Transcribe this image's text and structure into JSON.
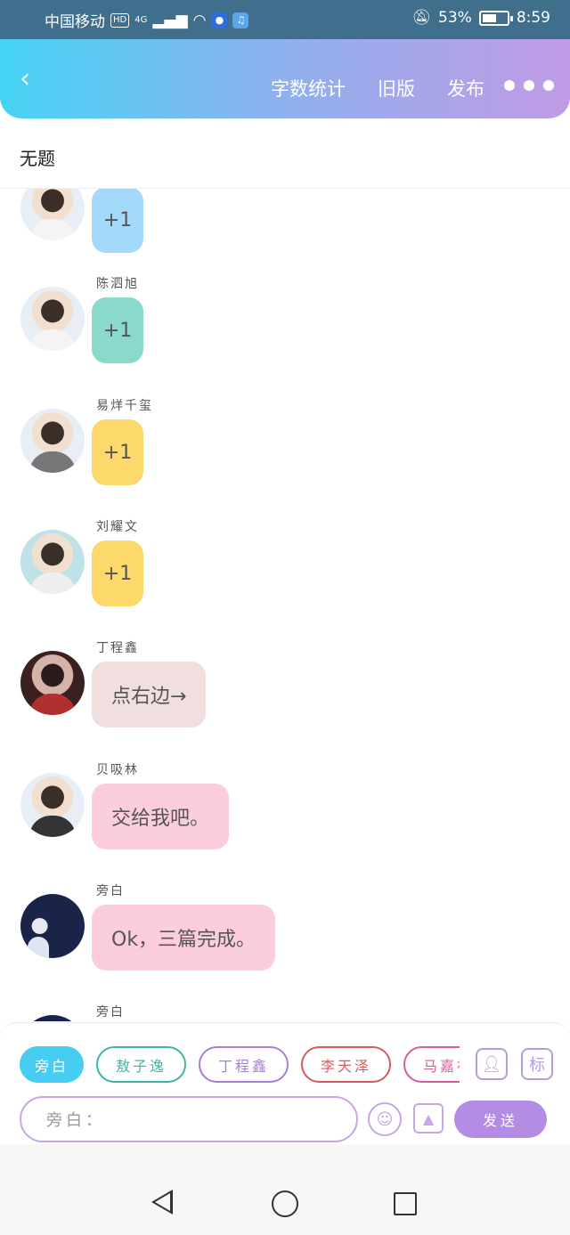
{
  "status_bar": {
    "carrier": "中国移动",
    "hd": "HD",
    "network": "4G",
    "battery": "53%",
    "time": "8:59"
  },
  "app_bar": {
    "actions": [
      "字数统计",
      "旧版",
      "发布"
    ]
  },
  "document": {
    "title": "无题"
  },
  "messages": [
    {
      "sender": "",
      "text": "+1",
      "bubble_color": "#a3d9fb"
    },
    {
      "sender": "陈泗旭",
      "text": "+1",
      "bubble_color": "#8ad9cc"
    },
    {
      "sender": "易烊千玺",
      "text": "+1",
      "bubble_color": "#fcd96a"
    },
    {
      "sender": "刘耀文",
      "text": "+1",
      "bubble_color": "#fcd96a"
    },
    {
      "sender": "丁程鑫",
      "text": "点右边→",
      "bubble_color": "#f1dede"
    },
    {
      "sender": "贝吸林",
      "text": "交给我吧。",
      "bubble_color": "#fccddd"
    },
    {
      "sender": "旁白",
      "text": "Ok，三篇完成。",
      "bubble_color": "#fccddd"
    },
    {
      "sender": "旁白",
      "text": "",
      "bubble_color": "#ffffff"
    }
  ],
  "composer": {
    "chips": [
      {
        "label": "旁白",
        "color": "#47cdf1",
        "active": true
      },
      {
        "label": "敖子逸",
        "color": "#3bb7a4",
        "active": false
      },
      {
        "label": "丁程鑫",
        "color": "#a57fd5",
        "active": false
      },
      {
        "label": "李天泽",
        "color": "#d45c5c",
        "active": false
      },
      {
        "label": "马嘉祺",
        "color": "#d55f9a",
        "active": false
      }
    ],
    "contact_icon": "contact-card-icon",
    "tag_icon_label": "标",
    "input_placeholder": "旁白：",
    "send_label": "发送"
  }
}
